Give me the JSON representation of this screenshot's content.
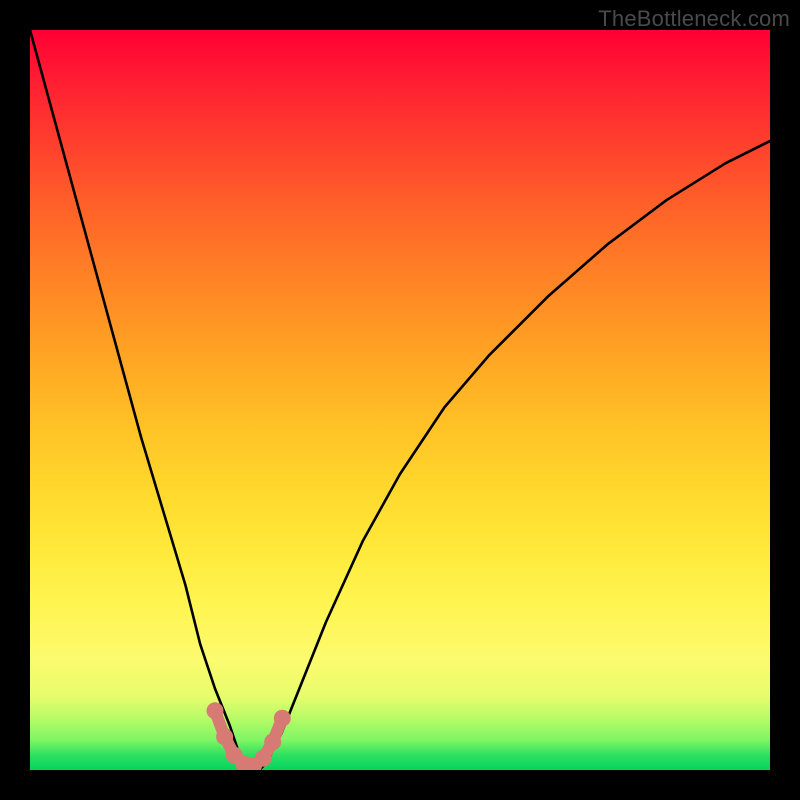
{
  "watermark": "TheBottleneck.com",
  "chart_data": {
    "type": "line",
    "title": "",
    "xlabel": "",
    "ylabel": "",
    "xlim": [
      0,
      100
    ],
    "ylim": [
      0,
      100
    ],
    "grid": false,
    "legend": false,
    "background_gradient_stops": [
      {
        "pct": 0,
        "color": "#ff0033"
      },
      {
        "pct": 50,
        "color": "#ffb326"
      },
      {
        "pct": 85,
        "color": "#fcfb6e"
      },
      {
        "pct": 100,
        "color": "#03d45e"
      }
    ],
    "series": [
      {
        "name": "bottleneck-curve",
        "stroke": "#000000",
        "x": [
          0,
          3,
          6,
          9,
          12,
          15,
          18,
          21,
          23,
          25,
          27,
          28,
          29,
          30,
          31,
          32,
          33,
          34,
          36,
          40,
          45,
          50,
          56,
          62,
          70,
          78,
          86,
          94,
          100
        ],
        "y": [
          100,
          89,
          78,
          67,
          56,
          45,
          35,
          25,
          17,
          11,
          6,
          3,
          1,
          0,
          0,
          1,
          3,
          5,
          10,
          20,
          31,
          40,
          49,
          56,
          64,
          71,
          77,
          82,
          85
        ]
      },
      {
        "name": "marker-dots",
        "stroke": "#d77a73",
        "marker": true,
        "x": [
          25.0,
          26.3,
          27.6,
          28.9,
          30.2,
          31.5,
          32.8,
          34.1
        ],
        "y": [
          8.0,
          4.5,
          2.0,
          0.8,
          0.6,
          1.6,
          3.8,
          7.0
        ]
      }
    ]
  }
}
